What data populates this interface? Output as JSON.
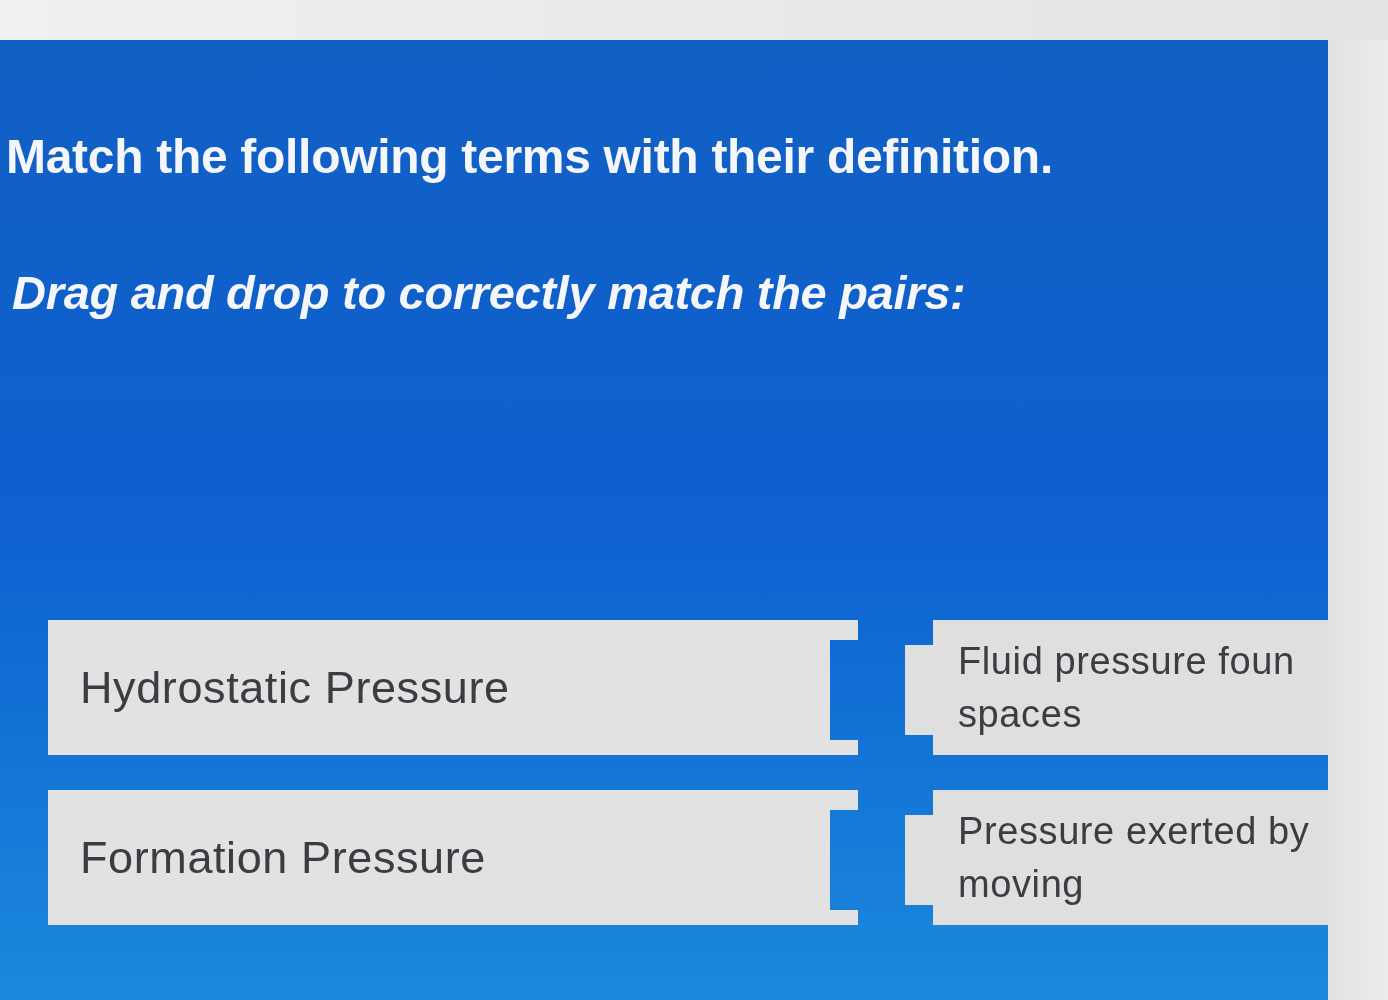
{
  "instructions": {
    "title": "Match the following terms with their definition.",
    "prompt": "Drag and drop to correctly match the pairs:"
  },
  "pairs": [
    {
      "term": "Hydrostatic Pressure",
      "definition_lines": [
        "Fluid pressure foun",
        "spaces"
      ]
    },
    {
      "term": "Formation Pressure",
      "definition_lines": [
        "Pressure exerted by",
        "moving"
      ]
    }
  ]
}
